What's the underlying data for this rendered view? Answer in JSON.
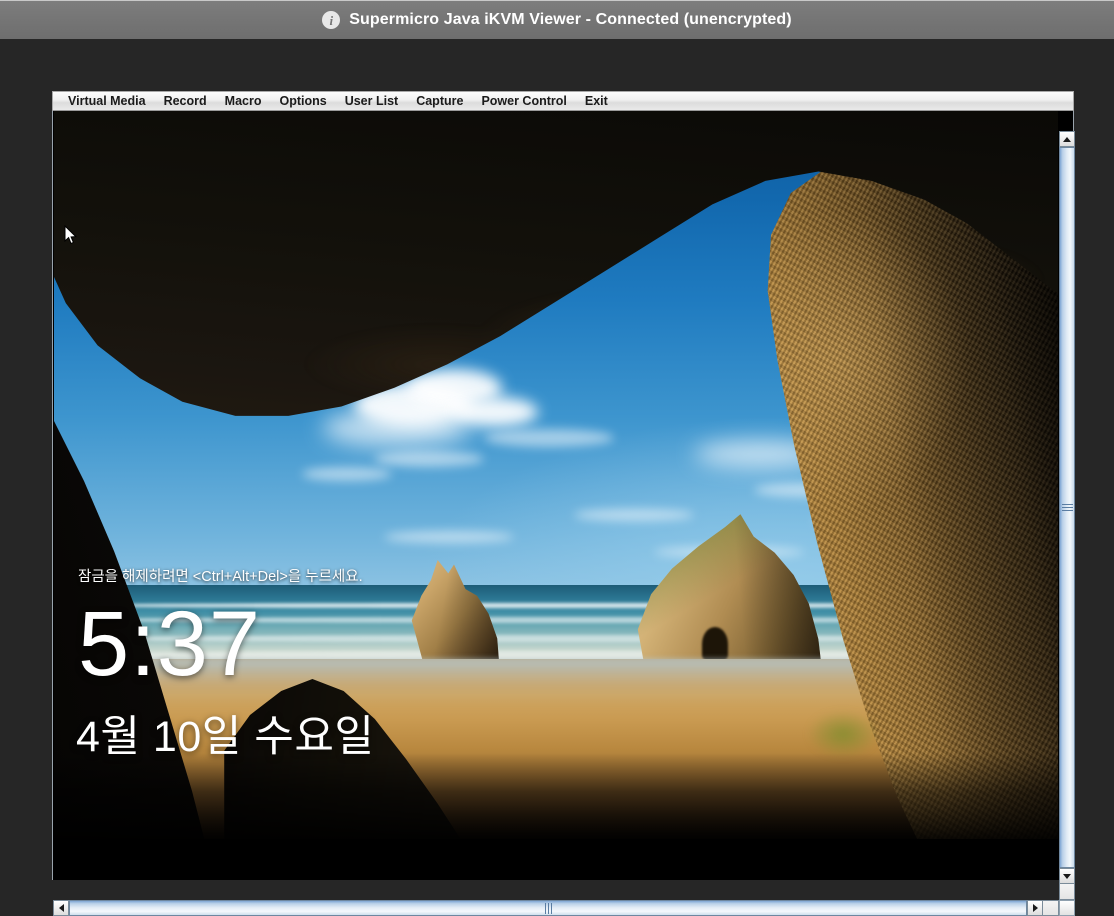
{
  "window": {
    "title": "Supermicro Java iKVM Viewer - Connected (unencrypted)",
    "info_icon": "info-icon"
  },
  "menubar": {
    "items": [
      {
        "label": "Virtual Media",
        "name": "menu-virtual-media"
      },
      {
        "label": "Record",
        "name": "menu-record"
      },
      {
        "label": "Macro",
        "name": "menu-macro"
      },
      {
        "label": "Options",
        "name": "menu-options"
      },
      {
        "label": "User List",
        "name": "menu-user-list"
      },
      {
        "label": "Capture",
        "name": "menu-capture"
      },
      {
        "label": "Power Control",
        "name": "menu-power-control"
      },
      {
        "label": "Exit",
        "name": "menu-exit"
      }
    ]
  },
  "remote_screen": {
    "description": "Windows 10 lock screen over Wharariki Beach cave wallpaper",
    "lock_hint": "잠금을 해제하려면 <Ctrl+Alt+Del>을 누르세요.",
    "clock": "5:37",
    "date": "4월 10일 수요일",
    "cursor": "arrow-cursor"
  },
  "scrollbars": {
    "vertical": {
      "up_arrow": "scroll-up-arrow",
      "down_arrow": "scroll-down-arrow",
      "thumb": "vertical-scroll-thumb"
    },
    "horizontal": {
      "left_arrow": "scroll-left-arrow",
      "right_arrow": "scroll-right-arrow",
      "thumb": "horizontal-scroll-thumb"
    }
  },
  "colors": {
    "titlebar": "#757575",
    "desktop": "#262626",
    "menubar": "#f0f0f0",
    "scroll_accent": "#b9d0e8",
    "lock_text": "#ffffff"
  }
}
